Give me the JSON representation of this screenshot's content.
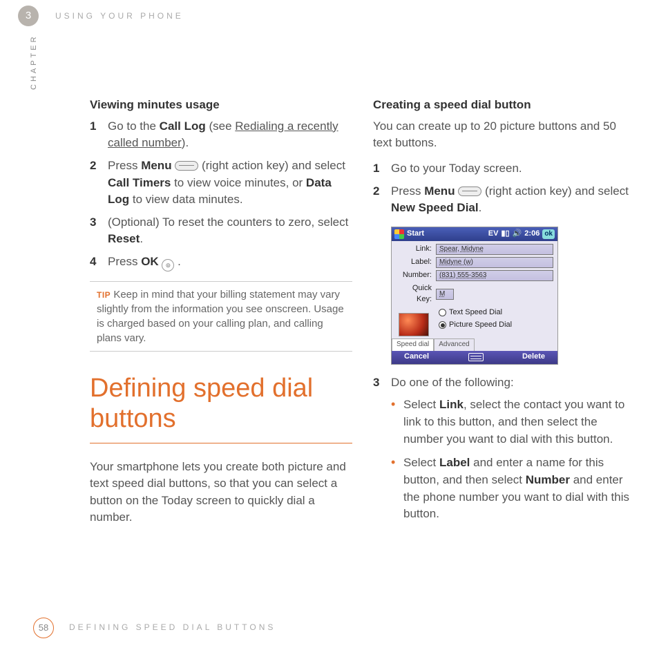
{
  "chapter_number": "3",
  "running_head": "USING YOUR PHONE",
  "chapter_label": "CHAPTER",
  "left": {
    "subhead": "Viewing minutes usage",
    "steps": [
      {
        "num": "1",
        "pre": "Go to the ",
        "bold1": "Call Log",
        "mid": " (see ",
        "link": "Redialing a recently called number",
        "post": ")."
      },
      {
        "num": "2",
        "pre": "Press ",
        "bold1": "Menu",
        "icon": "action-key",
        "mid2": " (right action key) and select ",
        "bold2": "Call Timers",
        "mid3": " to view voice minutes, or ",
        "bold3": "Data Log",
        "post": " to view data minutes."
      },
      {
        "num": "3",
        "pre": "(Optional) To reset the counters to zero, select ",
        "bold1": "Reset",
        "post": "."
      },
      {
        "num": "4",
        "pre": "Press ",
        "bold1": "OK",
        "icon": "ok-key",
        "post": " ."
      }
    ],
    "tip_label": "TIP",
    "tip_text": " Keep in mind that your billing statement may vary slightly from the information you see onscreen. Usage is charged based on your calling plan, and calling plans vary.",
    "section_title": "Defining speed dial buttons",
    "intro": "Your smartphone lets you create both picture and text speed dial buttons, so that you can select a button on the Today screen to quickly dial a number."
  },
  "right": {
    "subhead": "Creating a speed dial button",
    "intro": "You can create up to 20 picture buttons and 50 text buttons.",
    "steps12": [
      {
        "num": "1",
        "text": "Go to your Today screen."
      },
      {
        "num": "2",
        "pre": "Press ",
        "bold1": "Menu",
        "icon": "action-key",
        "mid": " (right action key) and select ",
        "bold2": "New Speed Dial",
        "post": "."
      }
    ],
    "phone": {
      "start": "Start",
      "status_ev": "EV",
      "time": "2:06",
      "ok": "ok",
      "link_label": "Link:",
      "link_value": "Spear, Midyne",
      "label_label": "Label:",
      "label_value": "Midyne (w)",
      "number_label": "Number:",
      "number_value": "(831) 555-3563",
      "quick_label": "Quick Key:",
      "quick_value": "M",
      "radio_text": "Text Speed Dial",
      "radio_picture": "Picture Speed Dial",
      "tab_speed": "Speed dial",
      "tab_adv": "Advanced",
      "menu_cancel": "Cancel",
      "menu_delete": "Delete"
    },
    "step3_num": "3",
    "step3_text": "Do one of the following:",
    "bullets": [
      {
        "pre": "Select ",
        "b1": "Link",
        "post": ", select the contact you want to link to this button, and then select the number you want to dial with this button."
      },
      {
        "pre": "Select ",
        "b1": "Label",
        "mid": " and enter a name for this button, and then select ",
        "b2": "Number",
        "post": " and enter the phone number you want to dial with this button."
      }
    ]
  },
  "page_number": "58",
  "footer_title": "DEFINING SPEED DIAL BUTTONS"
}
